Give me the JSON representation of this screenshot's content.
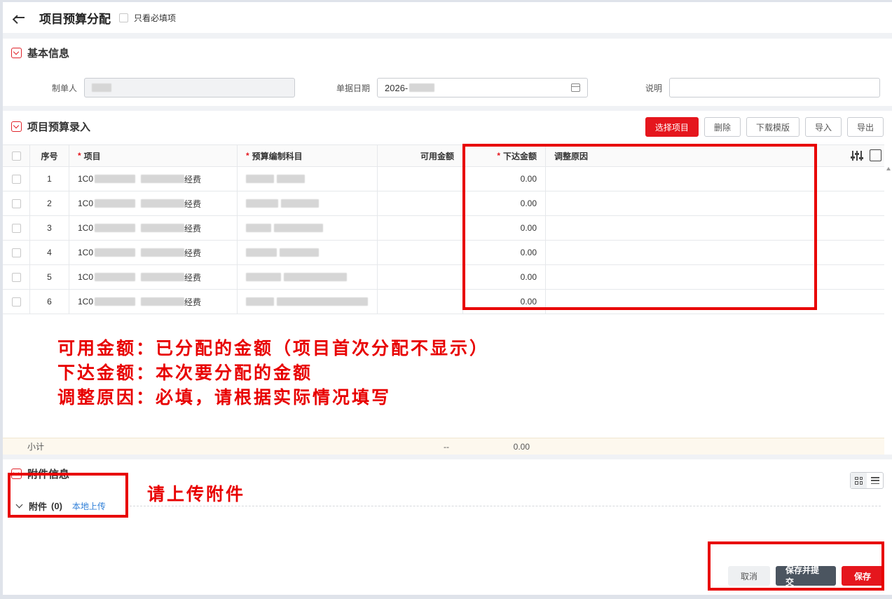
{
  "header": {
    "title": "项目预算分配",
    "required_only_label": "只看必填项"
  },
  "basic_info": {
    "title": "基本信息",
    "creator_label": "制单人",
    "date_label": "单据日期",
    "date_value": "2026-",
    "note_label": "说明",
    "note_value": ""
  },
  "budget_entry": {
    "title": "项目预算录入",
    "buttons": {
      "select": "选择项目",
      "delete": "删除",
      "download": "下载模版",
      "import": "导入",
      "export": "导出"
    },
    "columns": [
      "序号",
      "项目",
      "预算编制科目",
      "可用金额",
      "下达金额",
      "调整原因"
    ],
    "rows": [
      {
        "no": "1",
        "project_prefix": "1C0",
        "project_suffix": "经费",
        "available": "",
        "amount": "0.00",
        "reason": ""
      },
      {
        "no": "2",
        "project_prefix": "1C0",
        "project_suffix": "经费",
        "available": "",
        "amount": "0.00",
        "reason": ""
      },
      {
        "no": "3",
        "project_prefix": "1C0",
        "project_suffix": "经费",
        "available": "",
        "amount": "0.00",
        "reason": ""
      },
      {
        "no": "4",
        "project_prefix": "1C0",
        "project_suffix": "经费",
        "available": "",
        "amount": "0.00",
        "reason": ""
      },
      {
        "no": "5",
        "project_prefix": "1C0",
        "project_suffix": "经费",
        "available": "",
        "amount": "0.00",
        "reason": ""
      },
      {
        "no": "6",
        "project_prefix": "1C0",
        "project_suffix": "经费",
        "available": "",
        "amount": "0.00",
        "reason": ""
      }
    ],
    "subtotal": {
      "label": "小计",
      "available": "--",
      "amount": "0.00"
    }
  },
  "annotations": {
    "line1": "可用金额：已分配的金额（项目首次分配不显示）",
    "line2": "下达金额：本次要分配的金额",
    "line3": "调整原因：必填，请根据实际情况填写",
    "upload_hint": "请上传附件"
  },
  "attachments": {
    "title": "附件信息",
    "label": "附件",
    "count": "(0)",
    "upload_link": "本地上传"
  },
  "footer": {
    "cancel": "取消",
    "save_submit": "保存并提交",
    "save": "保存"
  },
  "colors": {
    "accent": "#e5161d",
    "annotation": "#e80000",
    "dark_button": "#4b5560"
  }
}
